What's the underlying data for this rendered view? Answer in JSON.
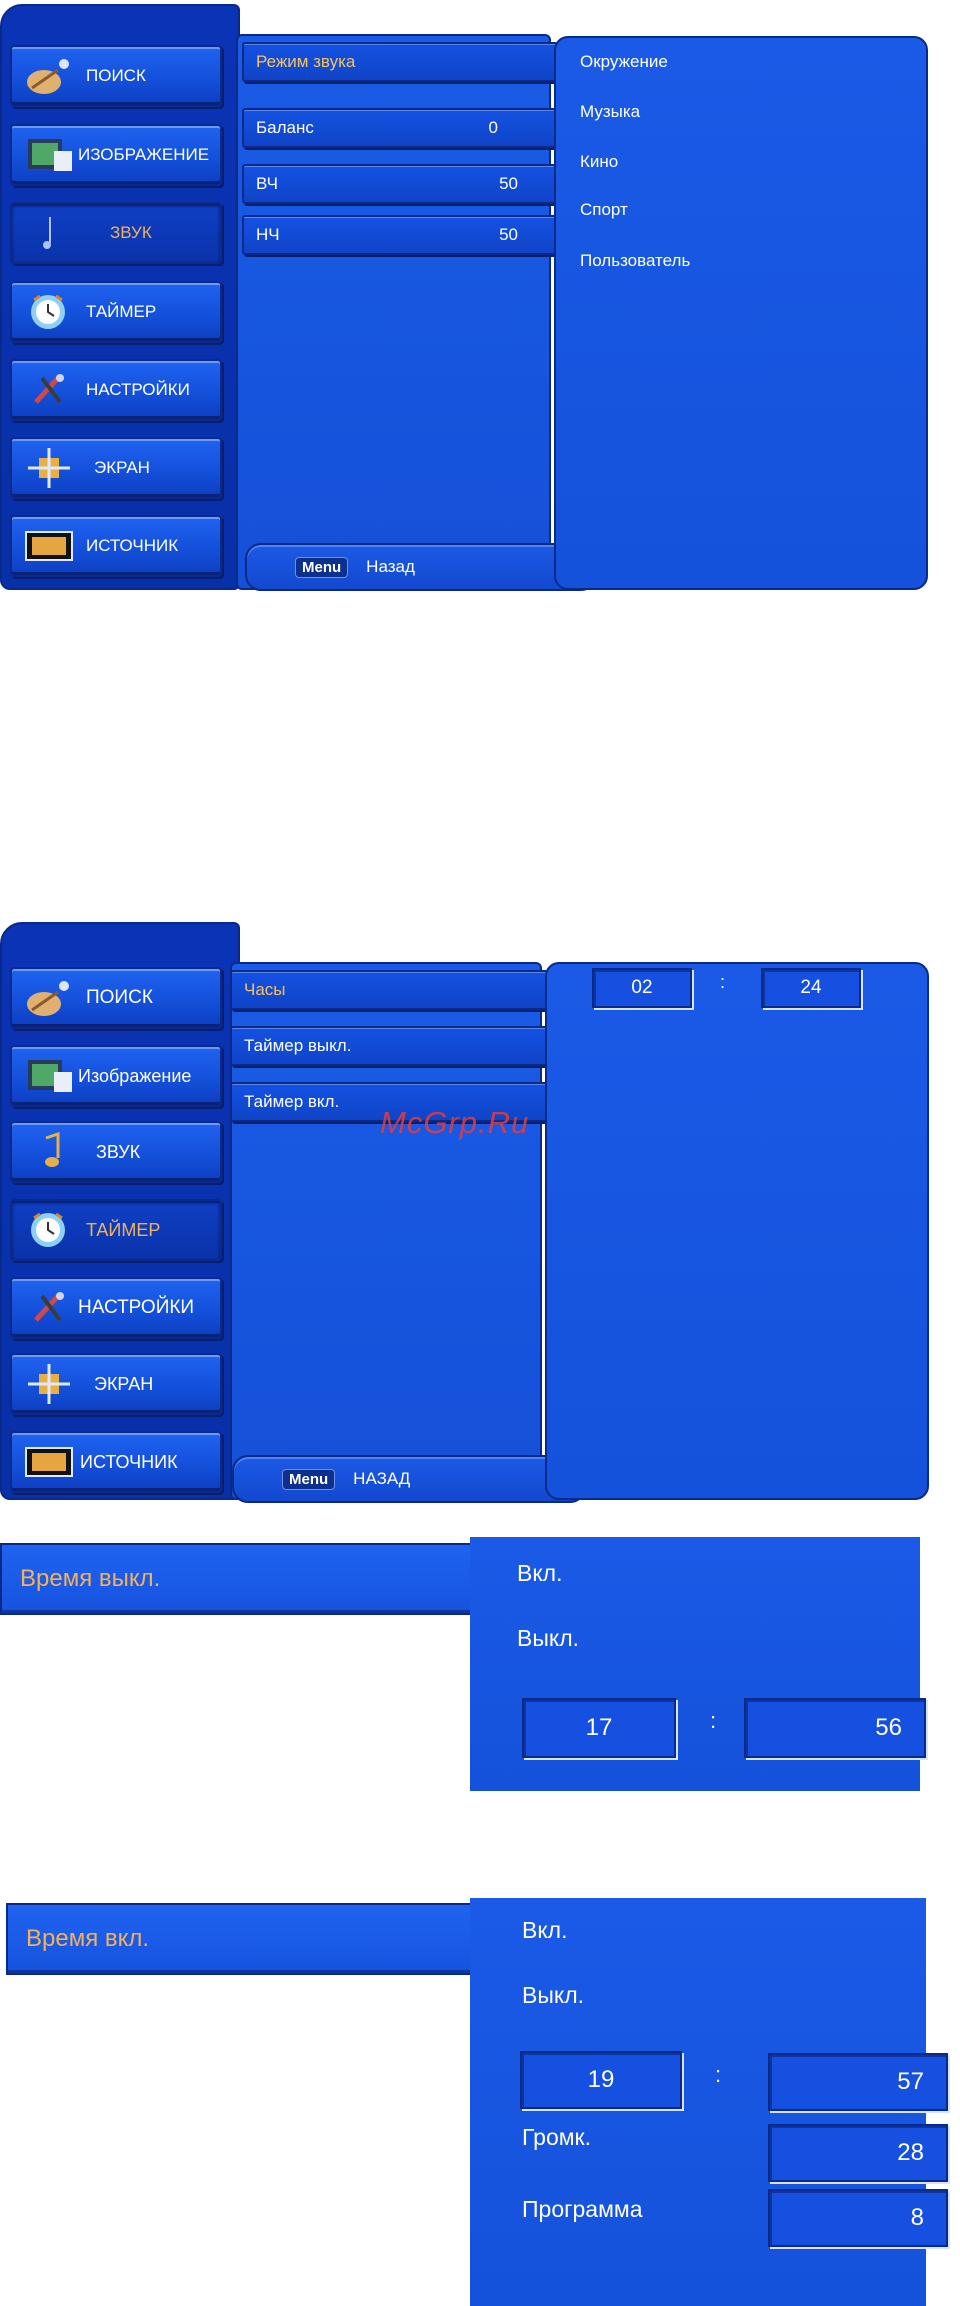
{
  "sound_menu": {
    "tabs": [
      {
        "label": "ПОИСК",
        "icon": "satellite-dish-icon",
        "active": false
      },
      {
        "label": "ИЗОБРАЖЕНИЕ",
        "icon": "picture-icon",
        "active": false
      },
      {
        "label": "ЗВУК",
        "icon": "music-note-icon",
        "active": true
      },
      {
        "label": "ТАЙМЕР",
        "icon": "clock-icon",
        "active": false
      },
      {
        "label": "НАСТРОЙКИ",
        "icon": "tools-icon",
        "active": false
      },
      {
        "label": "ЭКРАН",
        "icon": "screen-adjust-icon",
        "active": false
      },
      {
        "label": "ИСТОЧНИК",
        "icon": "input-source-icon",
        "active": false
      }
    ],
    "items": [
      {
        "label": "Режим звука",
        "value": "",
        "selected": true
      },
      {
        "label": "Баланс",
        "value": "0",
        "selected": false
      },
      {
        "label": "ВЧ",
        "value": "50",
        "selected": false
      },
      {
        "label": "НЧ",
        "value": "50",
        "selected": false
      }
    ],
    "footer": {
      "key": "Menu",
      "label": "Назад"
    },
    "options": [
      "Окружение",
      "Музыка",
      "Кино",
      "Спорт",
      "Пользователь"
    ]
  },
  "timer_menu": {
    "tabs": [
      {
        "label": "ПОИСК",
        "icon": "satellite-dish-icon",
        "active": false
      },
      {
        "label": "Изображение",
        "icon": "picture-icon",
        "active": false
      },
      {
        "label": "ЗВУК",
        "icon": "music-note-icon",
        "active": false
      },
      {
        "label": "ТАЙМЕР",
        "icon": "clock-icon",
        "active": true
      },
      {
        "label": "НАСТРОЙКИ",
        "icon": "tools-icon",
        "active": false
      },
      {
        "label": "ЭКРАН",
        "icon": "screen-adjust-icon",
        "active": false
      },
      {
        "label": "ИСТОЧНИК",
        "icon": "input-source-icon",
        "active": false
      }
    ],
    "items": [
      {
        "label": "Часы",
        "selected": true
      },
      {
        "label": "Таймер выкл.",
        "selected": false
      },
      {
        "label": "Таймер вкл.",
        "selected": false
      }
    ],
    "footer": {
      "key": "Menu",
      "label": "НАЗАД"
    },
    "clock": {
      "hours": "02",
      "minutes": "24"
    }
  },
  "off_timer": {
    "title": "Время выкл.",
    "on": "Вкл.",
    "off": "Выкл.",
    "hours": "17",
    "minutes": "56"
  },
  "on_timer": {
    "title": "Время вкл.",
    "on": "Вкл.",
    "off": "Выкл.",
    "hours": "19",
    "minutes": "57",
    "volume_label": "Громк.",
    "volume": "28",
    "program_label": "Программа",
    "program": "8"
  },
  "watermark": "McGrp.Ru",
  "colors": {
    "osd_blue": "#1552db",
    "highlight": "#f3b25a",
    "border": "#0a2a8a"
  }
}
